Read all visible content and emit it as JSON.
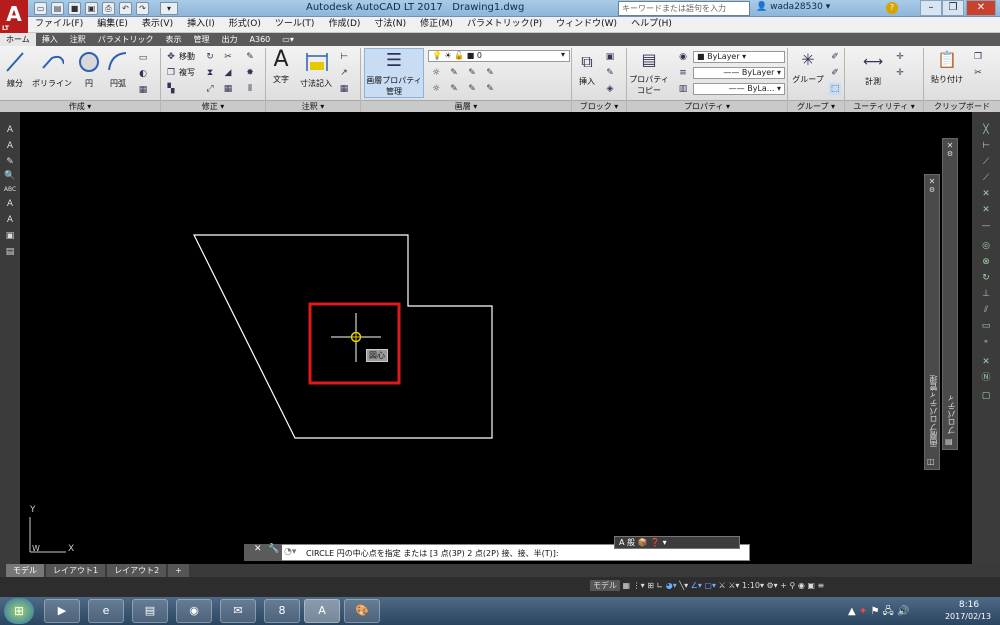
{
  "window": {
    "title": "Autodesk AutoCAD LT 2017",
    "document": "Drawing1.dwg",
    "search_placeholder": "キーワードまたは語句を入力",
    "user": "wada28530",
    "logo_text": "A",
    "logo_sub": "LT"
  },
  "menu": [
    "ファイル(F)",
    "編集(E)",
    "表示(V)",
    "挿入(I)",
    "形式(O)",
    "ツール(T)",
    "作成(D)",
    "寸法(N)",
    "修正(M)",
    "パラメトリック(P)",
    "ウィンドウ(W)",
    "ヘルプ(H)"
  ],
  "ribbon_tabs": [
    "ホーム",
    "挿入",
    "注釈",
    "パラメトリック",
    "表示",
    "管理",
    "出力",
    "A360"
  ],
  "ribbon": {
    "draw": {
      "title": "作成",
      "line": "線分",
      "polyline": "ポリライン",
      "circle": "円",
      "arc": "円弧"
    },
    "modify": {
      "title": "修正",
      "move": "移動",
      "copy": "複写"
    },
    "annotation": {
      "title": "注釈",
      "text": "文字",
      "dimension": "寸法記入"
    },
    "layers": {
      "title": "画層",
      "layer_props": "画層プロパティ",
      "layer_props2": "管理",
      "current_layer": "0"
    },
    "block": {
      "title": "ブロック",
      "insert": "挿入"
    },
    "properties": {
      "title": "プロパティ",
      "match": "プロパティ",
      "match2": "コピー",
      "color": "ByLayer",
      "linetype": "ByLayer",
      "lineweight": "ByLa..."
    },
    "groups": {
      "title": "グループ",
      "group": "グループ"
    },
    "utilities": {
      "title": "ユーティリティ",
      "measure": "計測"
    },
    "clipboard": {
      "title": "クリップボード",
      "paste": "貼り付け"
    }
  },
  "canvas": {
    "tooltip": "図心",
    "ucs_y": "Y",
    "ucs_x": "X",
    "ucs_w": "W"
  },
  "palettes": {
    "layer_props": "画層プロパティ管理",
    "properties": "プロパティ"
  },
  "command_line": {
    "prompt": "CIRCLE 円の中心点を指定 または [3 点(3P) 2 点(2P) 接、接、半(T)]:",
    "float_label": "A 般"
  },
  "layout_tabs": [
    "モデル",
    "レイアウト1",
    "レイアウト2",
    "+"
  ],
  "status": {
    "model": "モデル",
    "scale": "1:10"
  },
  "taskbar": {
    "time": "8:16",
    "date": "2017/02/13",
    "psp_label": "8"
  },
  "colors": {
    "highlight": "#e0191b",
    "drawing_lines": "#ffffff",
    "canvas_bg": "#000000",
    "osnap_marker": "#e6d000"
  }
}
